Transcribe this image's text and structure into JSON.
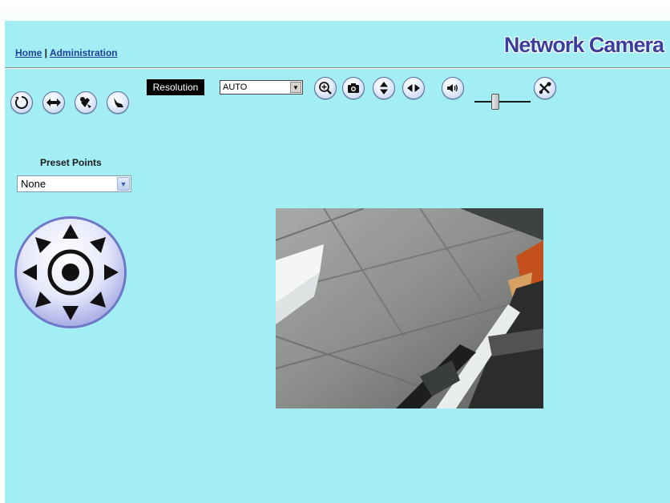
{
  "header": {
    "nav_home": "Home",
    "nav_sep": " | ",
    "nav_admin": "Administration",
    "brand": "Network Camera"
  },
  "left_panel": {
    "buttons": [
      "rotate-icon",
      "mirror-icon",
      "patrol-horizontal-icon",
      "patrol-vertical-icon"
    ],
    "preset_label": "Preset Points",
    "preset_value": "None"
  },
  "toolbar": {
    "resolution_label": "Resolution",
    "resolution_value": "AUTO",
    "buttons": [
      "zoom-icon",
      "snapshot-icon",
      "flip-vertical-icon",
      "flip-horizontal-icon",
      "speaker-icon",
      "settings-icon"
    ],
    "volume_level": 0.35
  },
  "colors": {
    "background": "#a3eef5",
    "brand": "#3a3f9e",
    "link": "#1d3f9a"
  }
}
